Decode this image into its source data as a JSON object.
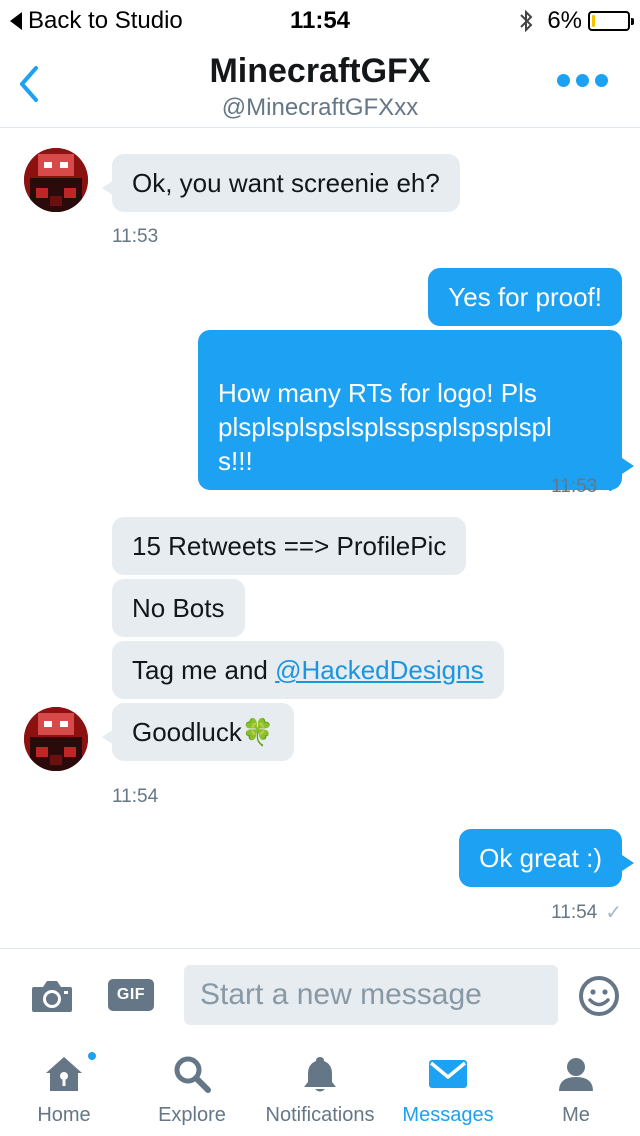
{
  "status_bar": {
    "back_label": "Back to Studio",
    "time": "11:54",
    "battery_text": "6%",
    "battery_level": 0.06
  },
  "header": {
    "title": "MinecraftGFX",
    "handle": "@MinecraftGFXxx"
  },
  "messages": [
    {
      "direction": "incoming",
      "text": "Ok, you want screenie eh?"
    },
    {
      "direction": "outgoing",
      "text": "Yes for proof!"
    },
    {
      "direction": "outgoing",
      "text": "How many RTs for logo! Pls\nplsplsplspslsplsspsplspsplspl\ns!!!"
    },
    {
      "direction": "incoming",
      "text": "15 Retweets ==> ProfilePic"
    },
    {
      "direction": "incoming",
      "text": "No Bots"
    },
    {
      "direction": "incoming",
      "text_prefix": "Tag me and ",
      "mention": "@HackedDesigns"
    },
    {
      "direction": "incoming",
      "text": "Goodluck",
      "emoji": "🍀"
    },
    {
      "direction": "outgoing",
      "text": "Ok great :)"
    }
  ],
  "timestamps": {
    "t1": "11:53",
    "t2": "11:53",
    "t3": "11:54",
    "t4": "11:54",
    "check": "✓"
  },
  "composer": {
    "gif_label": "GIF",
    "placeholder": "Start a new message"
  },
  "tabs": [
    {
      "label": "Home",
      "icon": "home-icon",
      "active": false,
      "badge_dot": true
    },
    {
      "label": "Explore",
      "icon": "search-icon",
      "active": false
    },
    {
      "label": "Notifications",
      "icon": "bell-icon",
      "active": false
    },
    {
      "label": "Messages",
      "icon": "envelope-icon",
      "active": true
    },
    {
      "label": "Me",
      "icon": "person-icon",
      "active": false
    }
  ],
  "colors": {
    "accent": "#1da1f2",
    "incoming_bubble": "#e6ecf0",
    "muted_text": "#657786"
  }
}
